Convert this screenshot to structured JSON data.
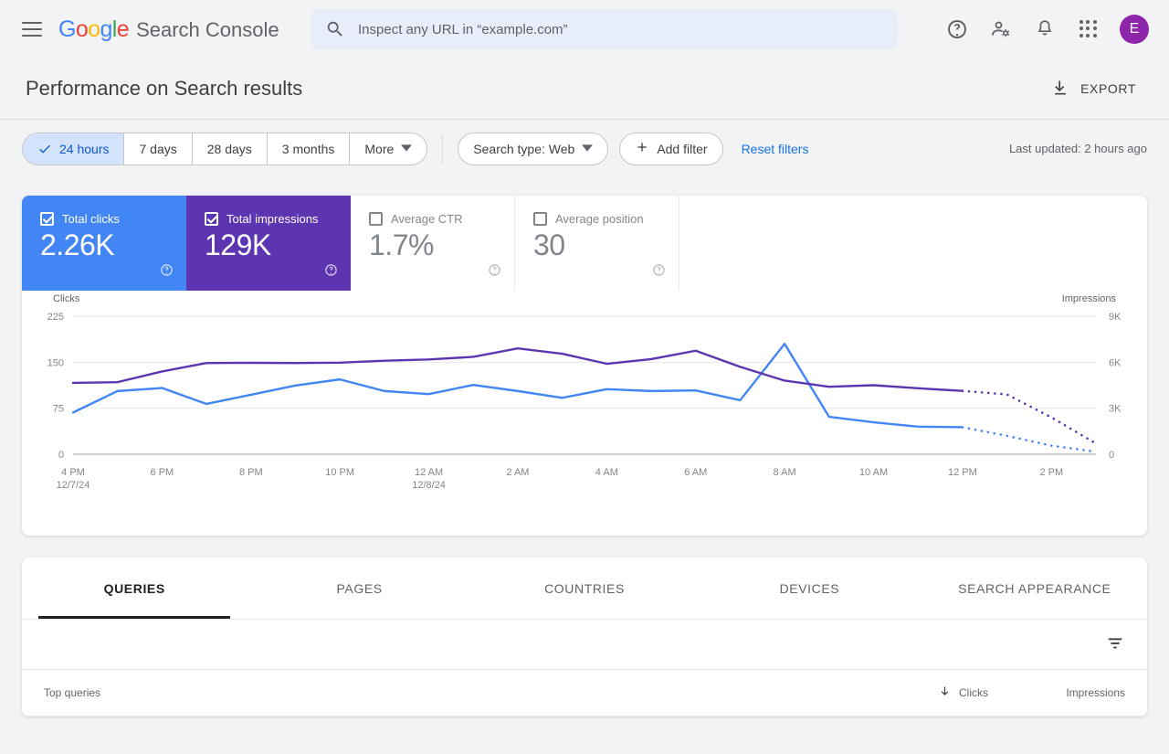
{
  "appbar": {
    "menu_icon": "hamburger-menu-icon",
    "logo_letters": [
      {
        "ch": "G",
        "color": "#4285f4"
      },
      {
        "ch": "o",
        "color": "#ea4335"
      },
      {
        "ch": "o",
        "color": "#fbbc05"
      },
      {
        "ch": "g",
        "color": "#4285f4"
      },
      {
        "ch": "l",
        "color": "#34a853"
      },
      {
        "ch": "e",
        "color": "#ea4335"
      }
    ],
    "product_name": "Search Console",
    "search_placeholder": "Inspect any URL in “example.com”",
    "search_value": "",
    "icons": [
      "help-icon",
      "account-settings-icon",
      "notifications-bell-icon",
      "apps-grid-icon"
    ],
    "avatar_letter": "E",
    "avatar_color": "#8e24aa"
  },
  "header": {
    "title": "Performance on Search results",
    "export_label": "EXPORT"
  },
  "filters": {
    "date_ranges": [
      {
        "label": "24 hours",
        "active": true
      },
      {
        "label": "7 days",
        "active": false
      },
      {
        "label": "28 days",
        "active": false
      },
      {
        "label": "3 months",
        "active": false
      },
      {
        "label": "More",
        "active": false,
        "caret": true
      }
    ],
    "search_type_label": "Search type: Web",
    "add_filter_label": "Add filter",
    "reset_label": "Reset filters",
    "last_updated": "Last updated: 2 hours ago"
  },
  "metrics": [
    {
      "label": "Total clicks",
      "value": "2.26K",
      "checked": true,
      "state": "sel-clicks",
      "color": "#4285f4"
    },
    {
      "label": "Total impressions",
      "value": "129K",
      "checked": true,
      "state": "sel-impr",
      "color": "#5e35b1"
    },
    {
      "label": "Average CTR",
      "value": "1.7%",
      "checked": false,
      "state": "unsel",
      "color": "#80868b"
    },
    {
      "label": "Average position",
      "value": "30",
      "checked": false,
      "state": "unsel",
      "color": "#80868b"
    }
  ],
  "chart_data": {
    "type": "line",
    "title": "",
    "xlabel": "",
    "ylabel": "Clicks",
    "y2label": "Impressions",
    "grid": true,
    "legend": "none",
    "x": [
      "4 PM",
      "5 PM",
      "6 PM",
      "7 PM",
      "8 PM",
      "9 PM",
      "10 PM",
      "11 PM",
      "12 AM",
      "1 AM",
      "2 AM",
      "3 AM",
      "4 AM",
      "5 AM",
      "6 AM",
      "7 AM",
      "8 AM",
      "9 AM",
      "10 AM",
      "11 AM",
      "12 PM",
      "1 PM",
      "2 PM",
      "3 PM"
    ],
    "tick_labels": [
      {
        "pos": 0,
        "top": "4 PM",
        "bottom": "12/7/24"
      },
      {
        "pos": 2,
        "top": "6 PM",
        "bottom": ""
      },
      {
        "pos": 4,
        "top": "8 PM",
        "bottom": ""
      },
      {
        "pos": 6,
        "top": "10 PM",
        "bottom": ""
      },
      {
        "pos": 8,
        "top": "12 AM",
        "bottom": "12/8/24"
      },
      {
        "pos": 10,
        "top": "2 AM",
        "bottom": ""
      },
      {
        "pos": 12,
        "top": "4 AM",
        "bottom": ""
      },
      {
        "pos": 14,
        "top": "6 AM",
        "bottom": ""
      },
      {
        "pos": 16,
        "top": "8 AM",
        "bottom": ""
      },
      {
        "pos": 18,
        "top": "10 AM",
        "bottom": ""
      },
      {
        "pos": 20,
        "top": "12 PM",
        "bottom": ""
      },
      {
        "pos": 22,
        "top": "2 PM",
        "bottom": ""
      }
    ],
    "ylim": [
      0,
      225
    ],
    "yticks": [
      0,
      75,
      150,
      225
    ],
    "ytick_labels": [
      "0",
      "75",
      "150",
      "225"
    ],
    "y2lim": [
      0,
      9000
    ],
    "y2ticks": [
      0,
      3000,
      6000,
      9000
    ],
    "y2tick_labels": [
      "0",
      "3K",
      "6K",
      "9K"
    ],
    "series": [
      {
        "name": "Total clicks",
        "color": "#4285f4",
        "axis": "left",
        "values": [
          68,
          103,
          108,
          82,
          97,
          112,
          122,
          103,
          98,
          113,
          103,
          92,
          106,
          103,
          104,
          88,
          180,
          61,
          52,
          45,
          44,
          null,
          null,
          null
        ],
        "projected_values": [
          null,
          null,
          null,
          null,
          null,
          null,
          null,
          null,
          null,
          null,
          null,
          null,
          null,
          null,
          null,
          null,
          null,
          null,
          null,
          null,
          44,
          30,
          14,
          4
        ]
      },
      {
        "name": "Total impressions",
        "color": "#5e35b1",
        "axis": "right",
        "values": [
          4650,
          4700,
          5400,
          5950,
          5960,
          5950,
          5970,
          6100,
          6180,
          6350,
          6900,
          6550,
          5900,
          6200,
          6750,
          5700,
          4800,
          4400,
          4500,
          4300,
          4130,
          null,
          null,
          null
        ],
        "projected_values": [
          null,
          null,
          null,
          null,
          null,
          null,
          null,
          null,
          null,
          null,
          null,
          null,
          null,
          null,
          null,
          null,
          null,
          null,
          null,
          null,
          4130,
          3900,
          2400,
          700
        ]
      }
    ]
  },
  "table": {
    "tabs": [
      {
        "label": "Queries",
        "active": true
      },
      {
        "label": "Pages",
        "active": false
      },
      {
        "label": "Countries",
        "active": false
      },
      {
        "label": "Devices",
        "active": false
      },
      {
        "label": "Search appearance",
        "active": false
      }
    ],
    "filter_icon": "filter-list-icon",
    "columns": {
      "query": "Top queries",
      "clicks": "Clicks",
      "impressions": "Impressions",
      "sort_indicator": "sort-descending-arrow-icon"
    },
    "rows": []
  }
}
